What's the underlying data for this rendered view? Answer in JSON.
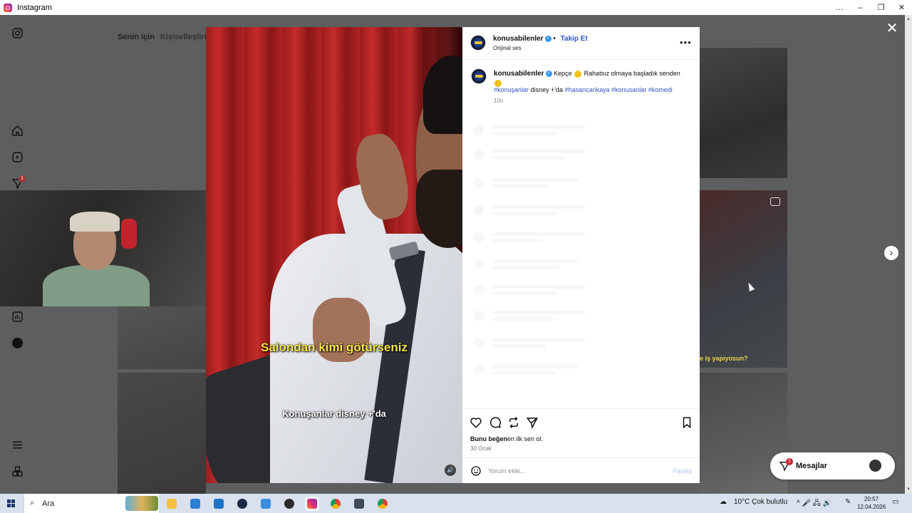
{
  "window": {
    "title": "Instagram",
    "minimize_icon": "…",
    "restore_icon": "–",
    "maximize_icon": "❐",
    "close_icon": "✕"
  },
  "feed": {
    "tabs": [
      "Senin için",
      "Kişiselleştirin"
    ],
    "thumb_caption": "e iş yapıyosun?"
  },
  "nav": {
    "notification_count": "1"
  },
  "modal": {
    "close_icon": "✕",
    "next_icon": "›",
    "video": {
      "subtitle_top": "Salondan kimi götürseniz",
      "subtitle_bottom": "Konuşanlar disney +'da",
      "mute_icon": "🔊"
    },
    "header": {
      "username": "konusabilenler",
      "separator": "•",
      "follow_label": "Takip Et",
      "audio_label": "Orijinal ses",
      "more_icon": "•••"
    },
    "caption": {
      "username": "konusabilenler",
      "text_part1": "Kepçe",
      "text_part2": "Rahatsız olmaya başladık senden",
      "hashtags": [
        "#konuşanlar",
        "#hasancankaya",
        "#konusanlar",
        "#komedi"
      ],
      "plain_text": "disney +'da",
      "time": "10h"
    },
    "actions": {
      "likes_bold": "Bunu beğen",
      "likes_rest": "en ilk sen ol.",
      "date": "30 Ocak"
    },
    "comment": {
      "placeholder": "Yorum ekle...",
      "post_label": "Paylaş"
    }
  },
  "messages": {
    "label": "Mesajlar",
    "badge": "1"
  },
  "taskbar": {
    "search_label": "Ara",
    "search_icon": "⌕",
    "weather": "10°C  Çok bulutlu",
    "time": "20:57",
    "date": "12.04.2026",
    "tray_icons": "^  🎤  🖧  🔊"
  },
  "colors": {
    "link_blue": "#3355c4",
    "verified_blue": "#3897f0",
    "subtitle_yellow": "#f4e34c",
    "overlay_gray": "#5d5e60",
    "taskbar": "#d9e1ee"
  }
}
